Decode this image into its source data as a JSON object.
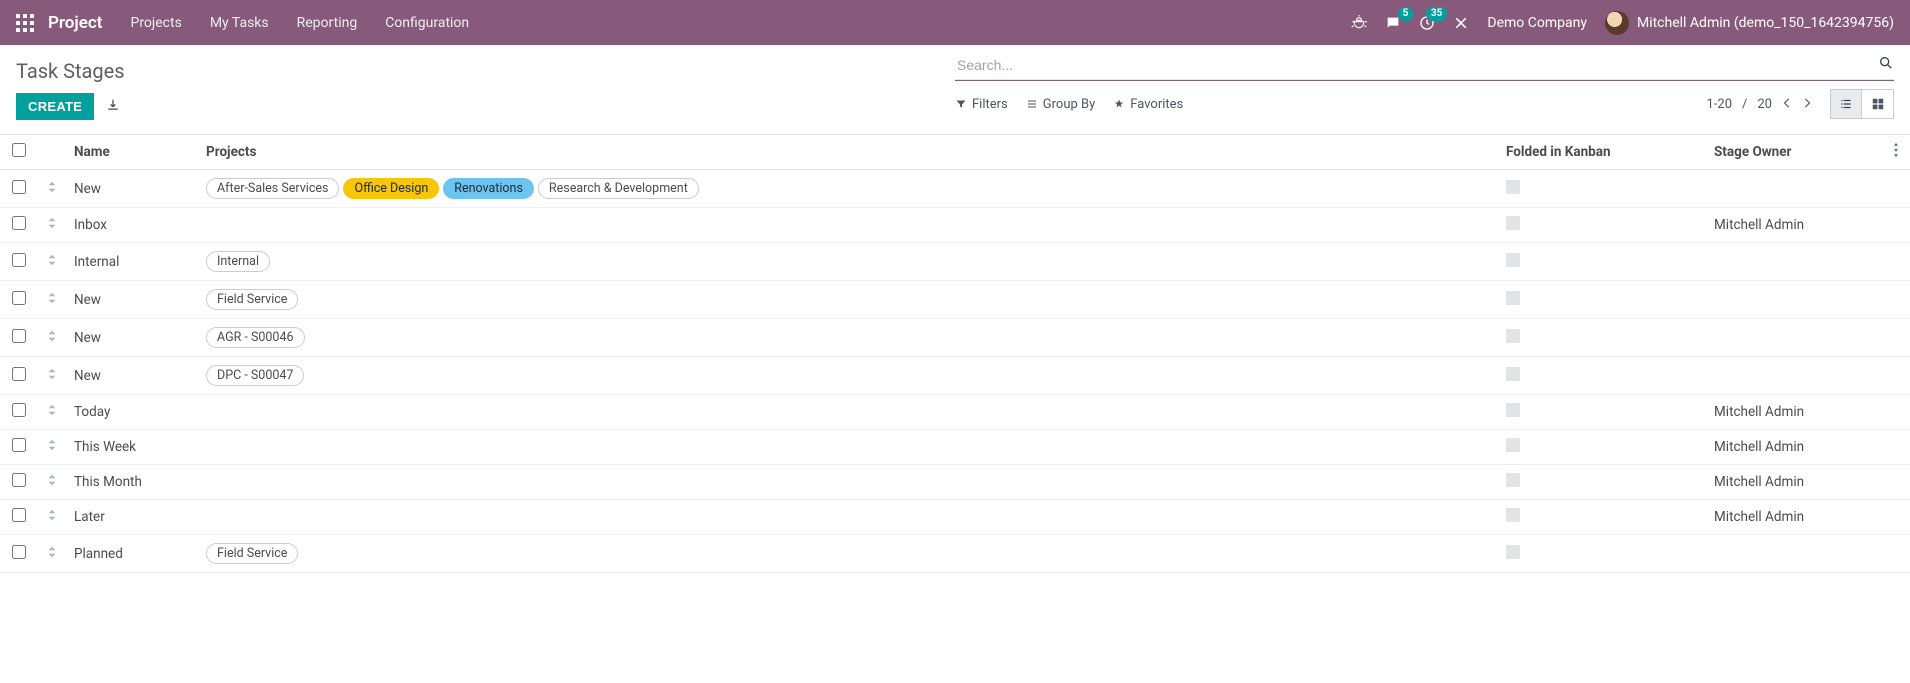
{
  "nav": {
    "brand": "Project",
    "items": [
      "Projects",
      "My Tasks",
      "Reporting",
      "Configuration"
    ],
    "messages_badge": "5",
    "activities_badge": "35",
    "company": "Demo Company",
    "user": "Mitchell Admin (demo_150_1642394756)"
  },
  "cp": {
    "breadcrumb": "Task Stages",
    "create_label": "CREATE",
    "search_placeholder": "Search...",
    "filters_label": "Filters",
    "groupby_label": "Group By",
    "favorites_label": "Favorites",
    "pager_value": "1-20",
    "pager_sep": "/",
    "pager_total": "20"
  },
  "table": {
    "headers": {
      "name": "Name",
      "projects": "Projects",
      "fold": "Folded in Kanban",
      "owner": "Stage Owner"
    },
    "rows": [
      {
        "name": "New",
        "projects": [
          {
            "label": "After-Sales Services",
            "bg": "#ffffff",
            "fg": "#4c4c4c",
            "border": "#cccccc"
          },
          {
            "label": "Office Design",
            "bg": "#f5c60a",
            "fg": "#1f2937",
            "border": "#f5c60a"
          },
          {
            "label": "Renovations",
            "bg": "#6cc4ef",
            "fg": "#1f2937",
            "border": "#6cc4ef"
          },
          {
            "label": "Research & Development",
            "bg": "#ffffff",
            "fg": "#4c4c4c",
            "border": "#cccccc"
          }
        ],
        "owner": ""
      },
      {
        "name": "Inbox",
        "projects": [],
        "owner": "Mitchell Admin"
      },
      {
        "name": "Internal",
        "projects": [
          {
            "label": "Internal",
            "bg": "#ffffff",
            "fg": "#4c4c4c",
            "border": "#cccccc"
          }
        ],
        "owner": ""
      },
      {
        "name": "New",
        "projects": [
          {
            "label": "Field Service",
            "bg": "#ffffff",
            "fg": "#4c4c4c",
            "border": "#cccccc"
          }
        ],
        "owner": ""
      },
      {
        "name": "New",
        "projects": [
          {
            "label": "AGR - S00046",
            "bg": "#ffffff",
            "fg": "#4c4c4c",
            "border": "#cccccc"
          }
        ],
        "owner": ""
      },
      {
        "name": "New",
        "projects": [
          {
            "label": "DPC - S00047",
            "bg": "#ffffff",
            "fg": "#4c4c4c",
            "border": "#cccccc"
          }
        ],
        "owner": ""
      },
      {
        "name": "Today",
        "projects": [],
        "owner": "Mitchell Admin"
      },
      {
        "name": "This Week",
        "projects": [],
        "owner": "Mitchell Admin"
      },
      {
        "name": "This Month",
        "projects": [],
        "owner": "Mitchell Admin"
      },
      {
        "name": "Later",
        "projects": [],
        "owner": "Mitchell Admin"
      },
      {
        "name": "Planned",
        "projects": [
          {
            "label": "Field Service",
            "bg": "#ffffff",
            "fg": "#4c4c4c",
            "border": "#cccccc"
          }
        ],
        "owner": ""
      }
    ]
  }
}
